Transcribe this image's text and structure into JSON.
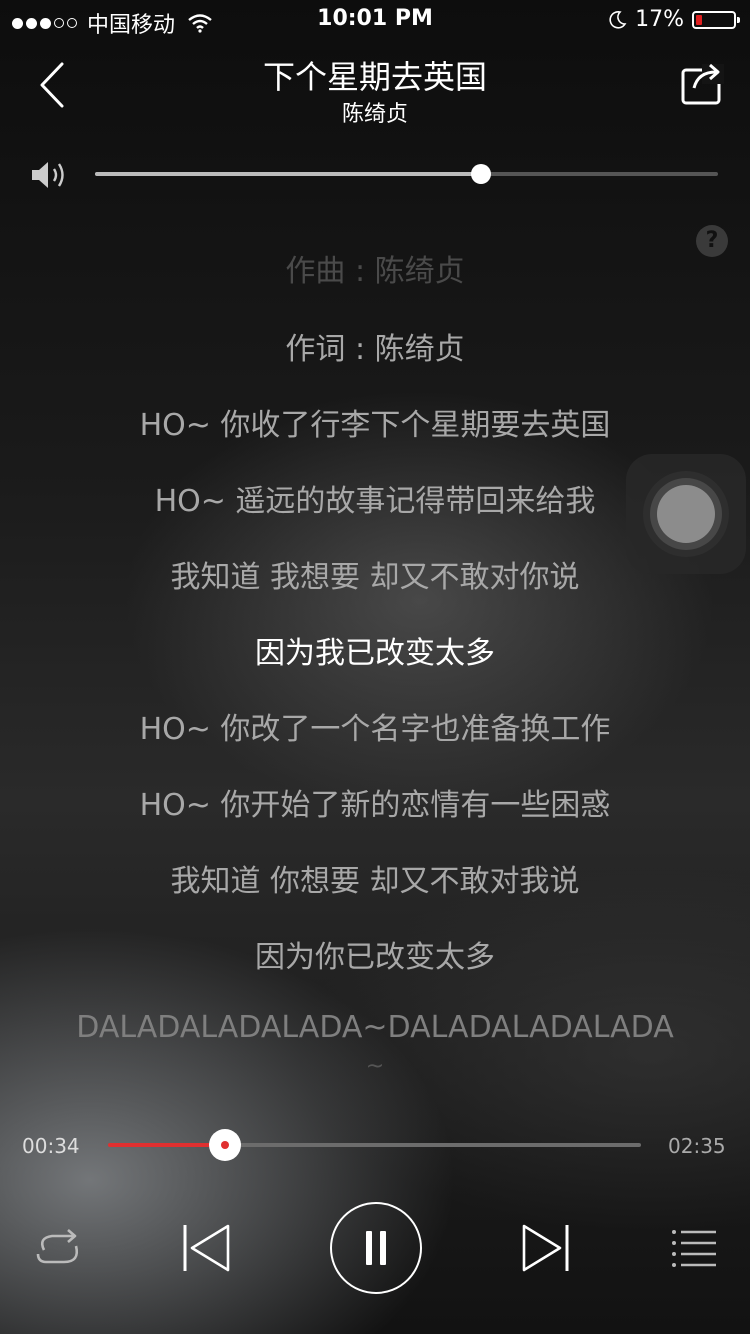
{
  "status_bar": {
    "carrier": "中国移动",
    "time": "10:01 PM",
    "battery_percent": "17%",
    "battery_level": 0.17,
    "signal_bars_filled": 3,
    "signal_bars_total": 5
  },
  "header": {
    "title": "下个星期去英国",
    "artist": "陈绮贞",
    "back_icon": "chevron-left-icon",
    "share_icon": "share-icon"
  },
  "volume": {
    "level": 0.62,
    "icon": "speaker-icon"
  },
  "help_label": "?",
  "lyrics": {
    "lines": [
      "作曲 : 陈绮贞",
      "作词 : 陈绮贞",
      "HO~ 你收了行李下个星期要去英国",
      "HO~ 遥远的故事记得带回来给我",
      "我知道 我想要 却又不敢对你说",
      "因为我已改变太多",
      "HO~ 你改了一个名字也准备换工作",
      "HO~ 你开始了新的恋情有一些困惑",
      "我知道 你想要 却又不敢对我说",
      "因为你已改变太多",
      "DALADALADALADA~DALADALADALADA",
      "~"
    ],
    "current_index": 5
  },
  "player": {
    "elapsed": "00:34",
    "total": "02:35",
    "progress": 0.219,
    "accent_color": "#e03030",
    "state": "playing"
  },
  "controls": {
    "repeat_icon": "repeat-icon",
    "prev_icon": "previous-track-icon",
    "pause_icon": "pause-icon",
    "next_icon": "next-track-icon",
    "playlist_icon": "playlist-icon"
  }
}
